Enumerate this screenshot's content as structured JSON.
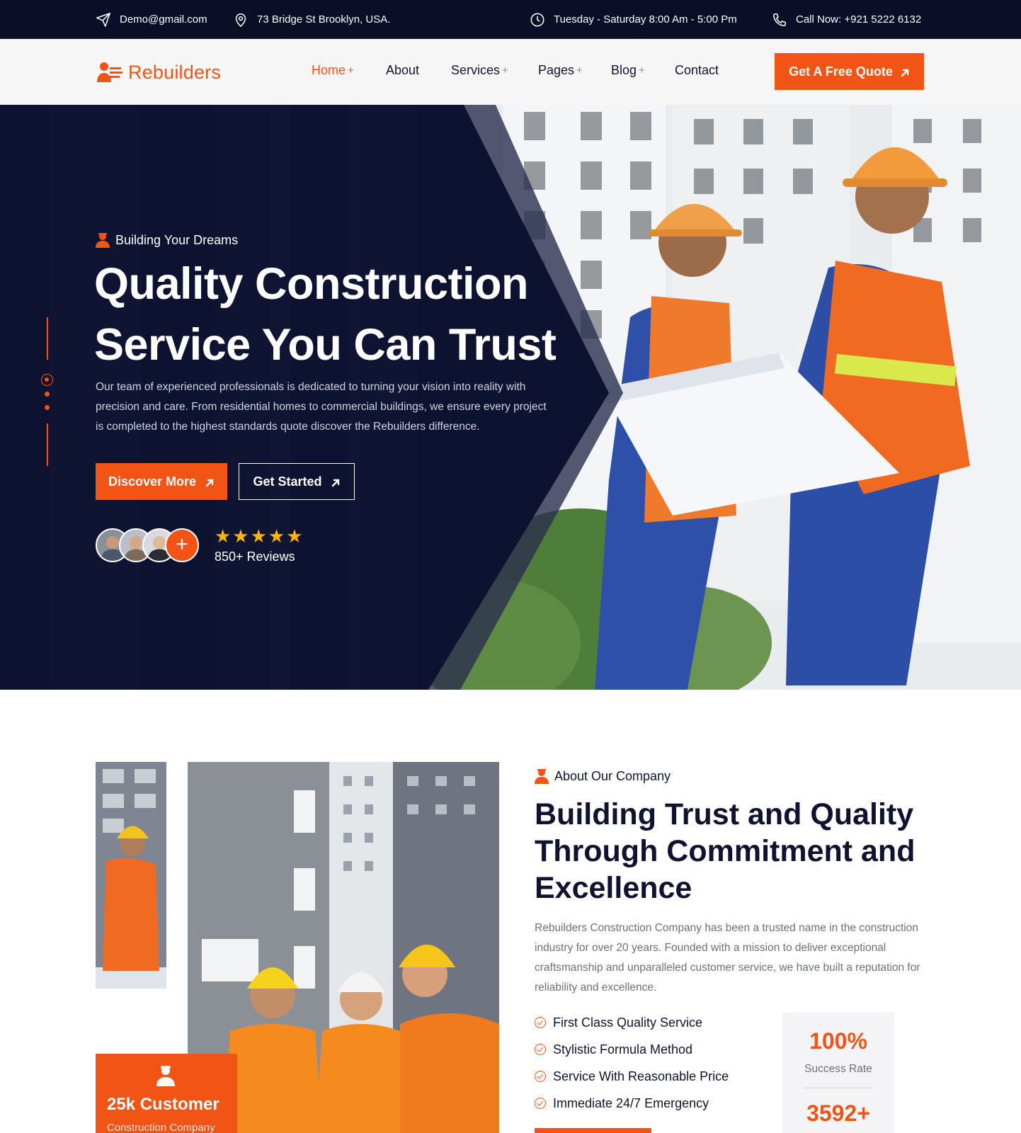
{
  "topbar": {
    "email": "Demo@gmail.com",
    "address": "73 Bridge St Brooklyn, USA.",
    "hours": "Tuesday - Saturday 8:00 Am - 5:00 Pm",
    "phone": "Call Now: +921 5222 6132"
  },
  "header": {
    "logo_text": "Rebuilders",
    "nav": [
      {
        "label": "Home",
        "plus": "+"
      },
      {
        "label": "About",
        "plus": ""
      },
      {
        "label": "Services",
        "plus": "+"
      },
      {
        "label": "Pages",
        "plus": "+"
      },
      {
        "label": "Blog",
        "plus": "+"
      },
      {
        "label": "Contact",
        "plus": ""
      }
    ],
    "quote_button": "Get A Free Quote"
  },
  "hero": {
    "tag": "Building Your Dreams",
    "title_line1": "Quality Construction",
    "title_line2": "Service You Can Trust",
    "description": "Our team of experienced professionals is dedicated to turning your vision into reality with precision and care. From residential homes to commercial buildings, we ensure every project is completed to the highest standards quote discover the Rebuilders difference.",
    "discover_button": "Discover More",
    "started_button": "Get Started",
    "avatar_plus": "+",
    "stars": "★★★★★",
    "rating": 5,
    "reviews": "850+ Reviews"
  },
  "about": {
    "tag": "About Our Company",
    "title": "Building Trust and Quality Through Commitment and Excellence",
    "description": "Rebuilders Construction Company has been a trusted name in the construction industry for over 20 years. Founded with a mission to deliver exceptional craftsmanship and unparalleled customer service, we have built a reputation for reliability and excellence.",
    "features": [
      "First Class Quality Service",
      "Stylistic Formula Method",
      "Service With Reasonable Price",
      "Immediate 24/7 Emergency"
    ],
    "customer_card": {
      "number": "25k Customer",
      "subtitle": "Construction Company"
    },
    "stats": [
      {
        "value": "100%",
        "label": "Success Rate"
      },
      {
        "value": "3592+",
        "label": ""
      }
    ]
  },
  "colors": {
    "accent": "#f25416",
    "dark": "#0a0e26",
    "star": "#ffb400"
  },
  "icons": {
    "email": "paper-plane-icon",
    "address": "map-pin-icon",
    "hours": "clock-icon",
    "phone": "phone-icon",
    "tag": "worker-icon",
    "check": "check-circle-icon",
    "arrow": "arrow-up-right-icon"
  }
}
